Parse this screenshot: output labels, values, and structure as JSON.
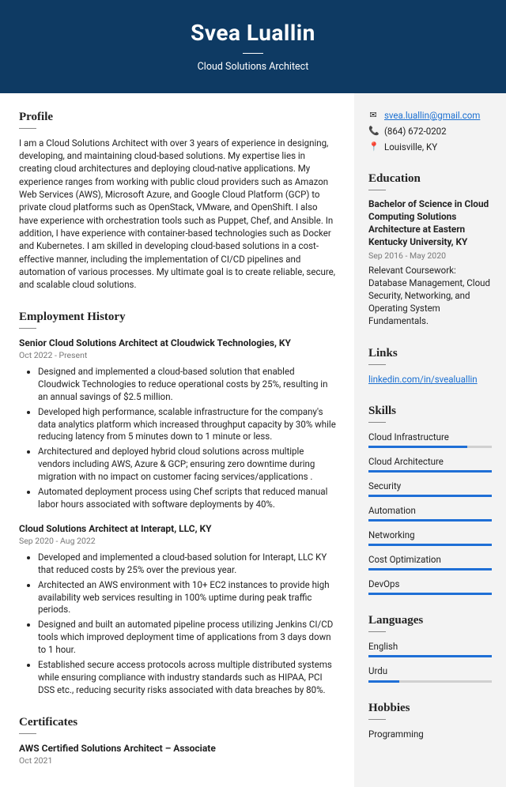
{
  "header": {
    "name": "Svea Luallin",
    "subtitle": "Cloud Solutions Architect"
  },
  "profile": {
    "title": "Profile",
    "text": "I am a Cloud Solutions Architect with over 3 years of experience in designing, developing, and maintaining cloud-based solutions. My expertise lies in creating cloud architectures and deploying cloud-native applications. My experience ranges from working with public cloud providers such as Amazon Web Services (AWS), Microsoft Azure, and Google Cloud Platform (GCP) to private cloud platforms such as OpenStack, VMware, and OpenShift. I also have experience with orchestration tools such as Puppet, Chef, and Ansible. In addition, I have experience with container-based technologies such as Docker and Kubernetes. I am skilled in developing cloud-based solutions in a cost-effective manner, including the implementation of CI/CD pipelines and automation of various processes. My ultimate goal is to create reliable, secure, and scalable cloud solutions."
  },
  "employment": {
    "title": "Employment History",
    "jobs": [
      {
        "title": "Senior Cloud Solutions Architect at Cloudwick Technologies, KY",
        "dates": "Oct 2022 - Present",
        "bullets": [
          "Designed and implemented a cloud-based solution that enabled Cloudwick Technologies to reduce operational costs by 25%, resulting in an annual savings of $2.5 million.",
          "Developed high performance, scalable infrastructure for the company's data analytics platform which increased throughput capacity by 30% while reducing latency from 5 minutes down to 1 minute or less.",
          "Architectured and deployed hybrid cloud solutions across multiple vendors including AWS, Azure & GCP; ensuring zero downtime during migration with no impact on customer facing services/applications .",
          "Automated deployment process using Chef scripts that reduced manual labor hours associated with software deployments by 40%."
        ]
      },
      {
        "title": "Cloud Solutions Architect at Interapt, LLC, KY",
        "dates": "Sep 2020 - Aug 2022",
        "bullets": [
          "Developed and implemented a cloud-based solution for Interapt, LLC KY that reduced costs by 25% over the previous year.",
          "Architected an AWS environment with 10+ EC2 instances to provide high availability web services resulting in 100% uptime during peak traffic periods.",
          "Designed and built an automated pipeline process utilizing Jenkins CI/CD tools which improved deployment time of applications from 3 days down to 1 hour.",
          "Established secure access protocols across multiple distributed systems while ensuring compliance with industry standards such as HIPAA, PCI DSS etc., reducing security risks associated with data breaches by 80%."
        ]
      }
    ]
  },
  "certificates": {
    "title": "Certificates",
    "items": [
      {
        "title": "AWS Certified Solutions Architect – Associate",
        "dates": "Oct 2021"
      }
    ]
  },
  "contact": {
    "email": "svea.luallin@gmail.com",
    "phone": "(864) 672-0202",
    "location": "Louisville, KY"
  },
  "education": {
    "title": "Education",
    "degree": "Bachelor of Science in Cloud Computing Solutions Architecture at Eastern Kentucky University, KY",
    "dates": "Sep 2016 - May 2020",
    "desc": "Relevant Coursework: Database Management, Cloud Security, Networking, and Operating System Fundamentals."
  },
  "links": {
    "title": "Links",
    "items": [
      {
        "text": "linkedin.com/in/svealuallin"
      }
    ]
  },
  "skills": {
    "title": "Skills",
    "items": [
      {
        "label": "Cloud Infrastructure",
        "pct": 80
      },
      {
        "label": "Cloud Architecture",
        "pct": 100
      },
      {
        "label": "Security",
        "pct": 100
      },
      {
        "label": "Automation",
        "pct": 100
      },
      {
        "label": "Networking",
        "pct": 100
      },
      {
        "label": "Cost Optimization",
        "pct": 100
      },
      {
        "label": "DevOps",
        "pct": 100
      }
    ]
  },
  "languages": {
    "title": "Languages",
    "items": [
      {
        "label": "English",
        "pct": 100
      },
      {
        "label": "Urdu",
        "pct": 25
      }
    ]
  },
  "hobbies": {
    "title": "Hobbies",
    "items": [
      "Programming"
    ]
  }
}
